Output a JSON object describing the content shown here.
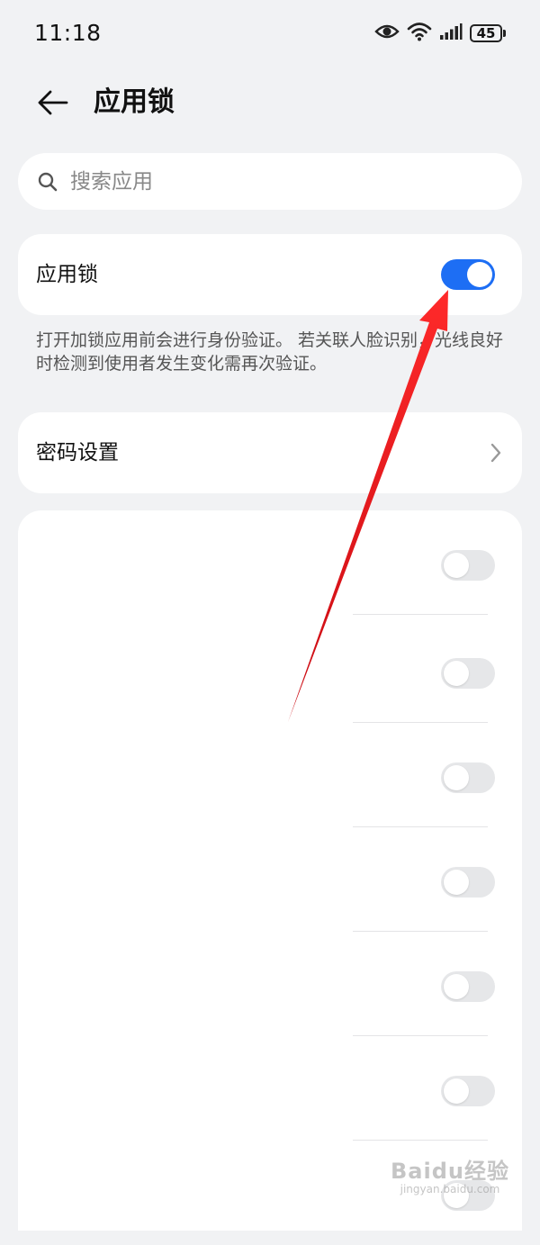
{
  "status_bar": {
    "time": "11:18",
    "battery_level": "45",
    "icons": [
      "eye-icon",
      "wifi-icon",
      "signal-icon",
      "battery-icon"
    ]
  },
  "header": {
    "back_icon": "arrow-left-icon",
    "title": "应用锁"
  },
  "search": {
    "placeholder": "搜索应用",
    "value": "",
    "icon": "search-icon"
  },
  "app_lock": {
    "label": "应用锁",
    "enabled": true,
    "description": "打开加锁应用前会进行身份验证。 若关联人脸识别，光线良好时检测到使用者发生变化需再次验证。"
  },
  "password_settings": {
    "label": "密码设置",
    "icon": "chevron-right-icon"
  },
  "app_list": {
    "rows": [
      {
        "enabled": false
      },
      {
        "enabled": false
      },
      {
        "enabled": false
      },
      {
        "enabled": false
      },
      {
        "enabled": false
      },
      {
        "enabled": false
      },
      {
        "enabled": false
      }
    ]
  },
  "annotation": {
    "arrow_color": "#e8101a"
  },
  "watermark": {
    "text": "Baidu经验",
    "subtext": "jingyan.baidu.com"
  },
  "colors": {
    "accent": "#1d6ef4",
    "background": "#f1f2f4",
    "toggle_off": "#e6e7e9"
  }
}
